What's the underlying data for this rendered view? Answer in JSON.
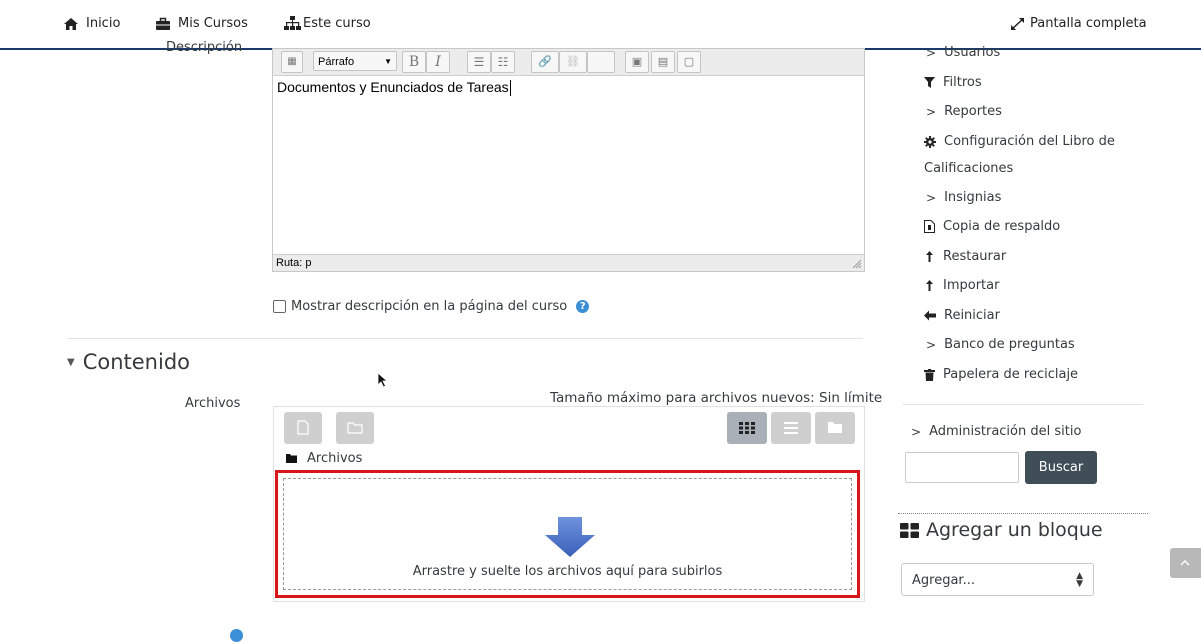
{
  "topnav": {
    "home": "Inicio",
    "my_courses": "Mis Cursos",
    "this_course": "Este curso",
    "fullscreen": "Pantalla completa"
  },
  "form": {
    "description_label": "Descripción",
    "editor": {
      "format_select": "Párrafo",
      "bold": "B",
      "italic": "I",
      "content": "Documentos y Enunciados de Tareas",
      "path": "Ruta: p"
    },
    "show_description_label": "Mostrar descripción en la página del curso",
    "content_section_title": "Contenido",
    "files_label": "Archivos",
    "max_size": "Tamaño máximo para archivos nuevos: Sin límite",
    "folder_name": "Archivos",
    "dropzone_text": "Arrastre y suelte los archivos aquí para subirlos"
  },
  "sidebar": {
    "items": [
      {
        "icon": "chevron-right-icon",
        "label": "Usuarios"
      },
      {
        "icon": "filter-icon",
        "label": "Filtros"
      },
      {
        "icon": "chevron-right-icon",
        "label": "Reportes"
      },
      {
        "icon": "gear-icon",
        "label": "Configuración del Libro de",
        "label2": "Calificaciones"
      },
      {
        "icon": "chevron-right-icon",
        "label": "Insignias"
      },
      {
        "icon": "file-backup-icon",
        "label": "Copia de respaldo"
      },
      {
        "icon": "restore-icon",
        "label": "Restaurar"
      },
      {
        "icon": "import-icon",
        "label": "Importar"
      },
      {
        "icon": "arrow-left-icon",
        "label": "Reiniciar"
      },
      {
        "icon": "chevron-right-icon",
        "label": "Banco de preguntas"
      },
      {
        "icon": "trash-icon",
        "label": "Papelera de reciclaje"
      }
    ],
    "site_admin": "Administración del sitio",
    "search_button": "Buscar",
    "search_value": "",
    "add_block_title": "Agregar un bloque",
    "add_block_select": "Agregar..."
  },
  "colors": {
    "nav_border": "#1a3a6b",
    "button_dark": "#3f4e57",
    "dropzone_highlight": "#d9141b",
    "help_icon": "#3b8fd4",
    "drop_arrow": "#4d73c9"
  }
}
